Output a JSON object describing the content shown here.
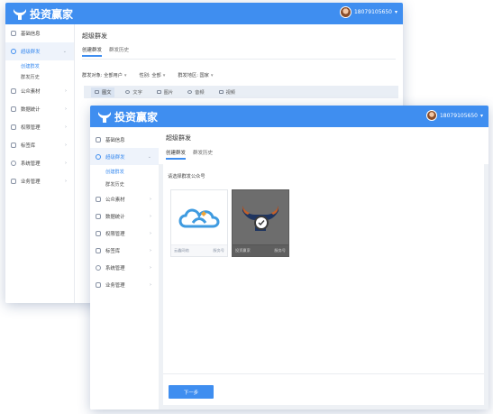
{
  "app": {
    "brand": "投资赢家",
    "username": "18079105650"
  },
  "sidebar": {
    "items": [
      {
        "label": "基础信息",
        "icon": "person-icon",
        "chevron": ""
      },
      {
        "label": "超级群发",
        "icon": "broadcast-icon",
        "chevron": "⌄"
      },
      {
        "label": "公众素材",
        "icon": "folder-icon",
        "chevron": "›"
      },
      {
        "label": "数据统计",
        "icon": "chart-icon",
        "chevron": "›"
      },
      {
        "label": "权限管理",
        "icon": "lock-icon",
        "chevron": "›"
      },
      {
        "label": "标签库",
        "icon": "tag-icon",
        "chevron": "›"
      },
      {
        "label": "系统管理",
        "icon": "gear-icon",
        "chevron": "›"
      },
      {
        "label": "业务管理",
        "icon": "briefcase-icon",
        "chevron": "›"
      }
    ],
    "sub_items": [
      {
        "label": "创建群发"
      },
      {
        "label": "群发历史"
      }
    ]
  },
  "page": {
    "title": "超级群发",
    "tabs": [
      {
        "label": "创建群发"
      },
      {
        "label": "群发历史"
      }
    ]
  },
  "back_window": {
    "filters": [
      {
        "label": "群发对象:",
        "value": "全部用户"
      },
      {
        "label": "性别:",
        "value": "全部"
      },
      {
        "label": "群发地区:",
        "value": "国家"
      }
    ],
    "content_types": [
      {
        "label": "图文",
        "icon": "news-icon"
      },
      {
        "label": "文字",
        "icon": "text-icon"
      },
      {
        "label": "图片",
        "icon": "image-icon"
      },
      {
        "label": "音频",
        "icon": "audio-icon"
      },
      {
        "label": "视频",
        "icon": "video-icon"
      }
    ]
  },
  "front_window": {
    "choose_label": "请选择群发公众号",
    "accounts": [
      {
        "name": "云鑫网络",
        "type": "服务号",
        "selected": false
      },
      {
        "name": "投资赢家",
        "type": "服务号",
        "selected": true
      }
    ],
    "next_button": "下一步"
  },
  "colors": {
    "accent": "#3f8ef0",
    "selected_overlay": "#6d6d6d"
  }
}
